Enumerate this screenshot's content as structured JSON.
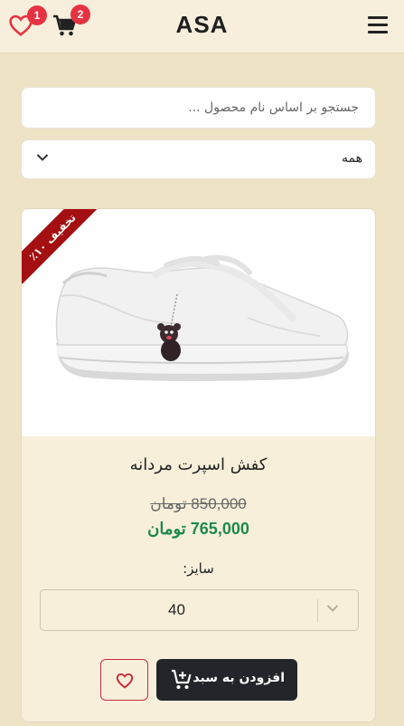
{
  "header": {
    "brand": "ASA",
    "wishlist_count": "1",
    "cart_count": "2"
  },
  "search": {
    "placeholder": "جستجو بر اساس نام محصول ..."
  },
  "filter": {
    "selected": "همه"
  },
  "product": {
    "badge": "تخفیف ۱۰٪",
    "name": "کفش اسپرت مردانه",
    "old_price": "850,000 تومان",
    "new_price": "765,000 تومان",
    "size_label": "سایز:",
    "size_value": "40",
    "add_to_cart": "افزودن به سبد"
  },
  "colors": {
    "background": "#efe3c6",
    "card": "#f8efdb",
    "badge_red": "#e63343",
    "ribbon": "#a40f12",
    "price_green": "#1d8a4a",
    "button_dark": "#23252a"
  },
  "icons": [
    "menu-icon",
    "heart-icon",
    "cart-icon",
    "chevron-down-icon",
    "cart-add-icon"
  ]
}
